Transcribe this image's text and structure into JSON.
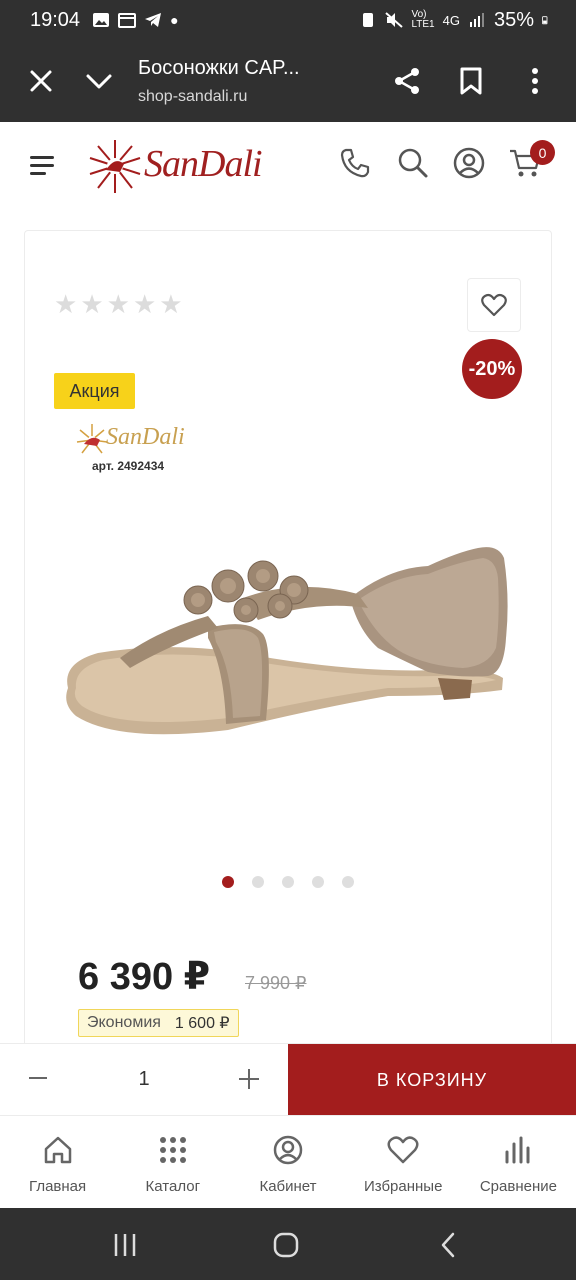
{
  "status_bar": {
    "time": "19:04",
    "network": "4G",
    "battery": "35%"
  },
  "browser": {
    "title": "Босоножки CAP...",
    "url": "shop-sandali.ru"
  },
  "header": {
    "logo": "SanDali",
    "cart_count": "0"
  },
  "product": {
    "rating_stars": "★★★★★",
    "discount": "-20%",
    "promo_label": "Акция",
    "brand_logo": "SanDali",
    "article": "арт. 2492434",
    "price": "6 390 ₽",
    "old_price": "7 990 ₽",
    "savings_label": "Экономия",
    "savings_amount": "1 600 ₽",
    "image_count": 5,
    "active_image": 1
  },
  "buy_bar": {
    "quantity": "1",
    "add_to_cart_label": "В КОРЗИНУ"
  },
  "bottom_nav": [
    {
      "label": "Главная",
      "icon": "home-icon"
    },
    {
      "label": "Каталог",
      "icon": "grid-icon"
    },
    {
      "label": "Кабинет",
      "icon": "user-icon"
    },
    {
      "label": "Избранные",
      "icon": "heart-icon"
    },
    {
      "label": "Сравнение",
      "icon": "compare-icon"
    }
  ],
  "colors": {
    "brand": "#a31d1d",
    "promo": "#f7d21a",
    "chrome": "#303030"
  }
}
